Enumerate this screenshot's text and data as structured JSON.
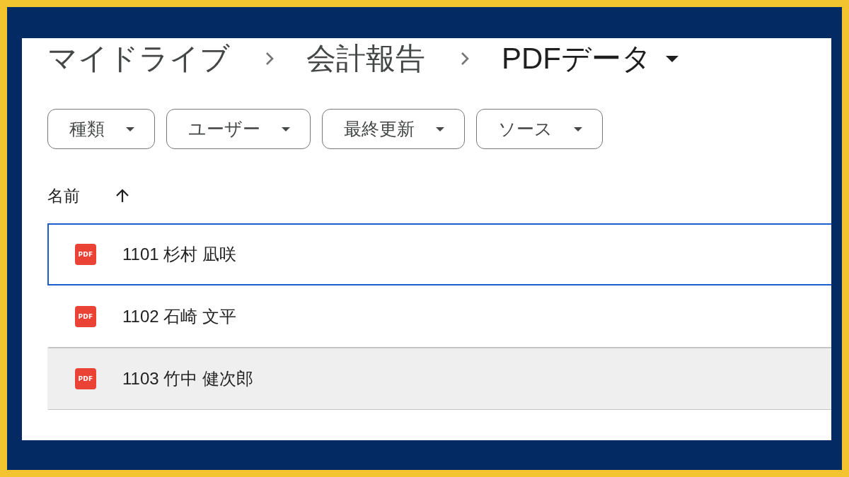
{
  "breadcrumb": [
    {
      "label": "マイドライブ",
      "current": false
    },
    {
      "label": "会計報告",
      "current": false
    },
    {
      "label": "PDFデータ",
      "current": true
    }
  ],
  "filters": [
    {
      "label": "種類"
    },
    {
      "label": "ユーザー"
    },
    {
      "label": "最終更新"
    },
    {
      "label": "ソース"
    }
  ],
  "file_list": {
    "columns": [
      {
        "label": "名前",
        "sort_ascending": true
      }
    ],
    "rows": [
      {
        "type_label": "PDF",
        "name": "1101 杉村 凪咲",
        "selected": true,
        "hovered": false
      },
      {
        "type_label": "PDF",
        "name": "1102 石崎 文平",
        "selected": false,
        "hovered": false
      },
      {
        "type_label": "PDF",
        "name": "1103 竹中 健次郎",
        "selected": false,
        "hovered": true
      }
    ]
  }
}
